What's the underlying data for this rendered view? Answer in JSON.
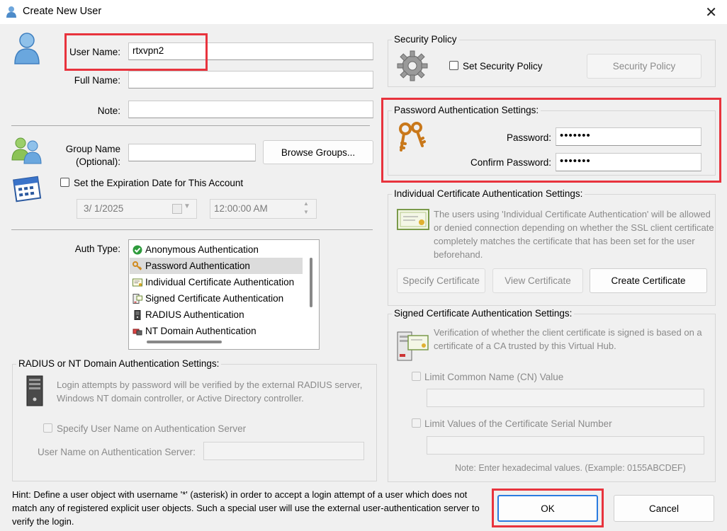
{
  "window": {
    "title": "Create New User",
    "close_glyph": "✕"
  },
  "user": {
    "user_name_label": "User Name:",
    "user_name_value": "rtxvpn2",
    "full_name_label": "Full Name:",
    "full_name_value": "",
    "note_label": "Note:",
    "note_value": ""
  },
  "group": {
    "label_line1": "Group Name",
    "label_line2": "(Optional):",
    "value": "",
    "browse_button": "Browse Groups..."
  },
  "expiration": {
    "checkbox_label": "Set the Expiration Date for This Account",
    "checked": false,
    "date_value": "3/  1/2025",
    "time_value": "12:00:00 AM"
  },
  "auth_type": {
    "label": "Auth Type:",
    "items": [
      {
        "label": "Anonymous Authentication",
        "icon": "check-circle-icon",
        "selected": false
      },
      {
        "label": "Password Authentication",
        "icon": "key-icon",
        "selected": true
      },
      {
        "label": "Individual Certificate Authentication",
        "icon": "certificate-icon",
        "selected": false
      },
      {
        "label": "Signed Certificate Authentication",
        "icon": "signed-certificate-icon",
        "selected": false
      },
      {
        "label": "RADIUS Authentication",
        "icon": "server-icon",
        "selected": false
      },
      {
        "label": "NT Domain Authentication",
        "icon": "domain-icon",
        "selected": false
      }
    ]
  },
  "radius": {
    "group_label": "RADIUS or NT Domain Authentication Settings:",
    "description": "Login attempts by password will be verified by the external RADIUS server, Windows NT domain controller, or Active Directory controller.",
    "specify_checkbox": "Specify User Name on Authentication Server",
    "server_user_label": "User Name on Authentication Server:",
    "server_user_value": ""
  },
  "security_policy": {
    "group_label": "Security Policy",
    "checkbox_label": "Set Security Policy",
    "checked": false,
    "button": "Security Policy"
  },
  "password_settings": {
    "group_label": "Password Authentication Settings:",
    "password_label": "Password:",
    "password_value": "•••••••",
    "confirm_label": "Confirm Password:",
    "confirm_value": "•••••••"
  },
  "individual_cert": {
    "group_label": "Individual Certificate Authentication Settings:",
    "description": "The users using 'Individual Certificate Authentication' will be allowed or denied connection depending on whether the SSL client certificate completely matches the certificate that has been set for the user beforehand.",
    "specify_button": "Specify Certificate",
    "view_button": "View Certificate",
    "create_button": "Create Certificate"
  },
  "signed_cert": {
    "group_label": "Signed Certificate Authentication Settings:",
    "description": "Verification of whether the client certificate is signed is based on a certificate of a CA trusted by this Virtual Hub.",
    "limit_cn_label": "Limit Common Name (CN) Value",
    "limit_cn_value": "",
    "limit_serial_label": "Limit Values of the Certificate Serial Number",
    "limit_serial_value": "",
    "note": "Note: Enter hexadecimal values. (Example: 0155ABCDEF)"
  },
  "hint": "Hint: Define a user object with username '*' (asterisk) in order to accept a login attempt of a user which does not match any of registered explicit user objects. Such a special user will use the external user-authentication server to verify the login.",
  "buttons": {
    "ok": "OK",
    "cancel": "Cancel"
  },
  "colors": {
    "highlight": "#e8333d",
    "ok_border": "#2a7be0",
    "dialog_bg": "#f0f0f0"
  }
}
